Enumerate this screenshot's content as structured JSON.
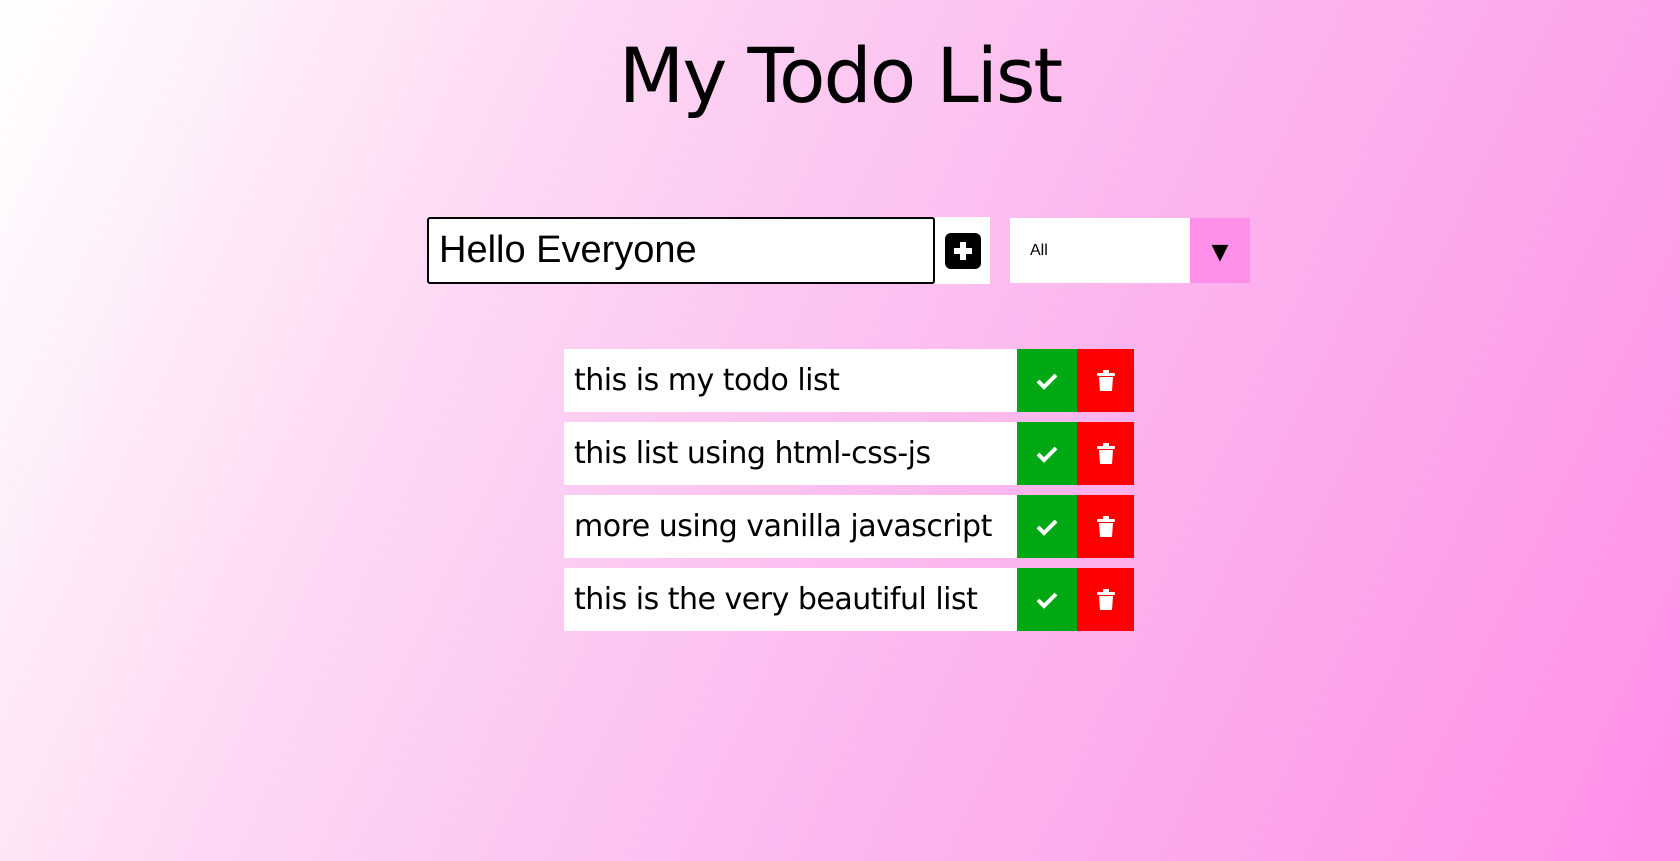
{
  "page": {
    "title": "My Todo List"
  },
  "form": {
    "input_value": "Hello Everyone",
    "add_icon": "plus-square-icon"
  },
  "filter": {
    "selected": "All",
    "arrow": "▼"
  },
  "todos": [
    {
      "text": "this is my todo list"
    },
    {
      "text": "this list using html-css-js"
    },
    {
      "text": "more using vanilla javascript"
    },
    {
      "text": "this is the very beautiful list"
    }
  ],
  "icons": {
    "complete": "check-icon",
    "delete": "trash-icon"
  },
  "colors": {
    "complete": "#00a814",
    "delete": "#ff0000",
    "accent": "#ff8fe8"
  }
}
